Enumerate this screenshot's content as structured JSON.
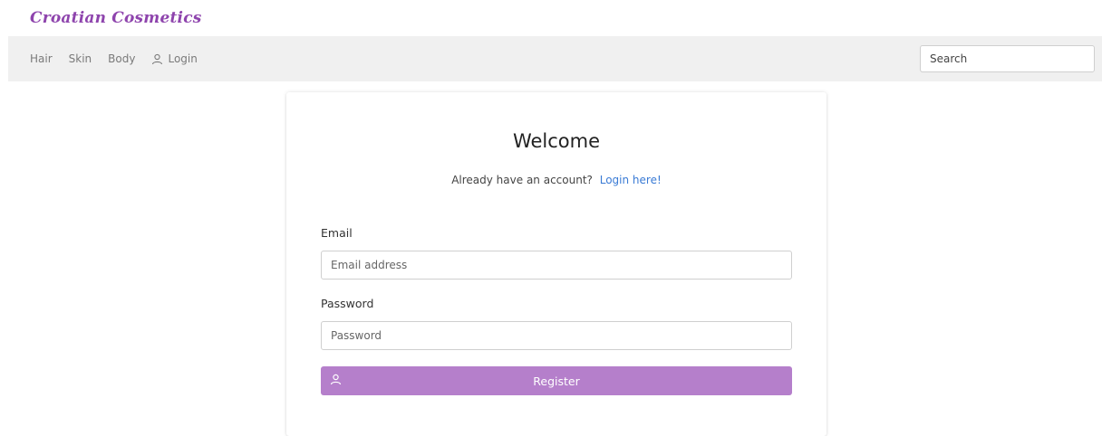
{
  "brand": {
    "name": "Croatian Cosmetics",
    "color": "#8e44ad"
  },
  "nav": {
    "items": [
      {
        "label": "Hair"
      },
      {
        "label": "Skin"
      },
      {
        "label": "Body"
      },
      {
        "label": "Login",
        "icon": "user-icon"
      }
    ],
    "search_placeholder": "Search"
  },
  "form": {
    "title": "Welcome",
    "subtitle": "Already have an account?",
    "login_link": "Login here!",
    "email_label": "Email",
    "email_placeholder": "Email address",
    "password_label": "Password",
    "password_placeholder": "Password",
    "register_label": "Register",
    "register_icon": "user-icon",
    "accent_color": "#b57fcb",
    "link_color": "#3a7bd5"
  }
}
